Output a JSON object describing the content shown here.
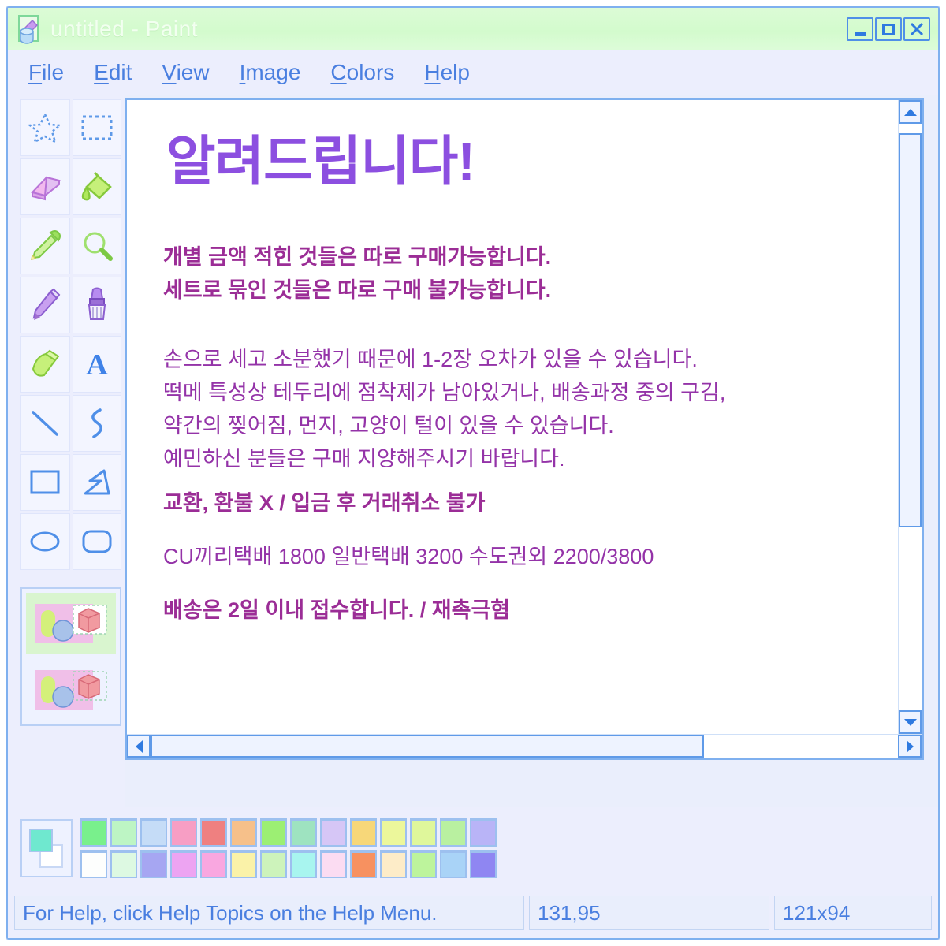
{
  "window": {
    "title": "untitled - Paint",
    "icon": "paint-bucket-icon",
    "controls": {
      "minimize": "_",
      "maximize": "□",
      "close": "✕"
    }
  },
  "menubar": {
    "items": [
      {
        "label": "File",
        "accel": "F",
        "rest": "ile"
      },
      {
        "label": "Edit",
        "accel": "E",
        "rest": "dit"
      },
      {
        "label": "View",
        "accel": "V",
        "rest": "iew"
      },
      {
        "label": "Image",
        "accel": "I",
        "rest": "mage"
      },
      {
        "label": "Colors",
        "accel": "C",
        "rest": "olors"
      },
      {
        "label": "Help",
        "accel": "H",
        "rest": "elp"
      }
    ]
  },
  "toolbox": {
    "tools": [
      {
        "name": "free-form-select-icon",
        "label": "Free-Form Select"
      },
      {
        "name": "rectangular-select-icon",
        "label": "Select"
      },
      {
        "name": "eraser-icon",
        "label": "Eraser/Color Eraser"
      },
      {
        "name": "fill-with-color-icon",
        "label": "Fill With Color"
      },
      {
        "name": "pick-color-icon",
        "label": "Pick Color"
      },
      {
        "name": "magnifier-icon",
        "label": "Magnifier"
      },
      {
        "name": "pencil-icon",
        "label": "Pencil"
      },
      {
        "name": "brush-icon",
        "label": "Brush"
      },
      {
        "name": "airbrush-icon",
        "label": "Airbrush"
      },
      {
        "name": "text-icon",
        "label": "Text"
      },
      {
        "name": "line-icon",
        "label": "Line"
      },
      {
        "name": "curve-icon",
        "label": "Curve"
      },
      {
        "name": "rectangle-icon",
        "label": "Rectangle"
      },
      {
        "name": "polygon-icon",
        "label": "Polygon"
      },
      {
        "name": "ellipse-icon",
        "label": "Ellipse"
      },
      {
        "name": "rounded-rectangle-icon",
        "label": "Rounded Rectangle"
      }
    ],
    "options": [
      {
        "name": "opaque-selection-option",
        "label": "Opaque background"
      },
      {
        "name": "transparent-selection-option",
        "label": "Transparent background"
      }
    ]
  },
  "canvas": {
    "heading": "알려드립니다!",
    "blocks": [
      {
        "style": "bold",
        "lines": [
          "개별 금액 적힌 것들은 따로 구매가능합니다.",
          "세트로 묶인 것들은 따로 구매 불가능합니다."
        ]
      },
      {
        "style": "light",
        "lines": [
          "손으로 세고 소분했기 때문에 1-2장 오차가 있을 수 있습니다.",
          "떡메 특성상 테두리에 점착제가 남아있거나, 배송과정 중의 구김,",
          "약간의 찢어짐, 먼지, 고양이 털이 있을 수 있습니다.",
          "예민하신 분들은 구매 지양해주시기 바랍니다."
        ]
      },
      {
        "style": "bold",
        "lines": [
          "교환, 환불 X / 입금 후 거래취소 불가"
        ]
      },
      {
        "style": "light",
        "lines": [
          "CU끼리택배 1800 일반택배 3200 수도권외 2200/3800"
        ]
      },
      {
        "style": "bold",
        "lines": [
          "배송은 2일 이내 접수합니다. / 재촉극혐"
        ]
      }
    ]
  },
  "palette": {
    "foreground": "#6fe8cf",
    "background": "#ffffff",
    "row1": [
      "#79f08c",
      "#bdf5c4",
      "#c5dcf7",
      "#f79ec4",
      "#ef8080",
      "#f6c08a",
      "#9cef73",
      "#9ee3c0",
      "#d6c6f6",
      "#f7d779",
      "#ecf79b",
      "#dff79b",
      "#b9f0a0",
      "#b9b4f7"
    ],
    "row2": [
      "#fdfefd",
      "#ddf9e2",
      "#a6a6f2",
      "#eda4f2",
      "#f9a7e0",
      "#faf2a8",
      "#cdf3bb",
      "#a8f5ef",
      "#fbdcf2",
      "#f79160",
      "#fdecc8",
      "#bdf49c",
      "#a9d3f7",
      "#8f86f2"
    ]
  },
  "statusbar": {
    "help": "For Help, click Help Topics on the Help Menu.",
    "coordinates": "131,95",
    "selection_size": "121x94"
  }
}
